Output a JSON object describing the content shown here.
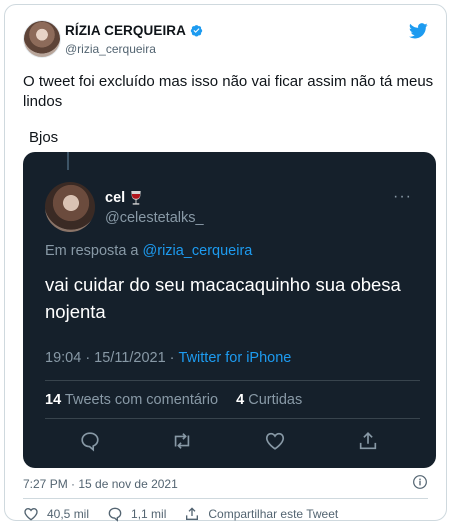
{
  "author": {
    "name": "RÍZIA CERQUEIRA",
    "handle": "@rizia_cerqueira",
    "verified": true
  },
  "tweet": {
    "text": "O tweet foi excluído mas isso não vai ficar assim não tá meus lindos",
    "text2": "Bjos"
  },
  "screenshot": {
    "name": "cel",
    "handle": "@celestetalks_",
    "replying_prefix": "Em resposta a ",
    "replying_to": "@rizia_cerqueira",
    "text": "vai cuidar do seu macacaquinho sua obesa nojenta",
    "time": "19:04 · 15/11/2021",
    "sep": "·",
    "source": "Twitter for iPhone",
    "retweets_count": "14",
    "retweets_label": "Tweets com comentário",
    "likes_count": "4",
    "likes_label": "Curtidas",
    "colors": {
      "background": "#15202b",
      "accent": "#1d9bf0",
      "muted": "#8899a6"
    }
  },
  "footer": {
    "timestamp": "7:27 PM · 15 de nov de 2021",
    "likes": "40,5 mil",
    "replies": "1,1 mil",
    "share_label": "Compartilhar este Tweet"
  },
  "icons": {
    "brand": "twitter-bird-icon",
    "verified": "verified-badge-icon",
    "emoji": "wine-glass-icon",
    "info": "info-icon",
    "like": "heart-icon",
    "reply": "comment-icon",
    "share": "share-icon"
  }
}
